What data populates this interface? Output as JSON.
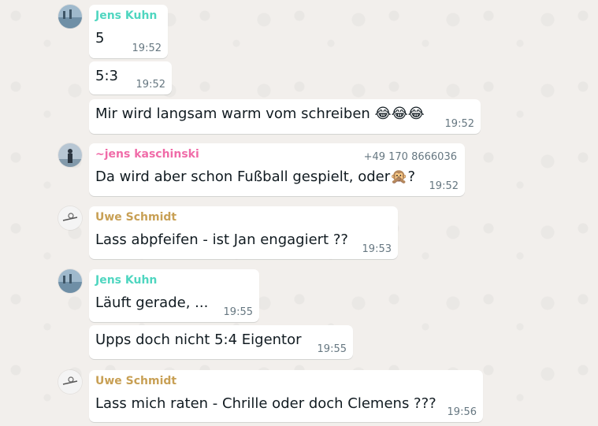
{
  "colors": {
    "background": "#f2efec",
    "bubble": "#ffffff",
    "sender_jens_kuhn": "#4fd6c0",
    "sender_jens_kaschinski": "#f06ba8",
    "sender_uwe": "#c8a055",
    "timestamp": "#667781"
  },
  "messages": [
    {
      "sender": "Jens Kuhn",
      "text": "5",
      "time": "19:52"
    },
    {
      "text": "5:3",
      "time": "19:52"
    },
    {
      "text": "Mir wird langsam warm vom schreiben 😂😂😂",
      "time": "19:52"
    },
    {
      "sender": "~jens kaschinski",
      "phone": "+49 170 8666036",
      "text": "Da wird aber schon Fußball gespielt, oder🙊?",
      "time": "19:52"
    },
    {
      "sender": "Uwe Schmidt",
      "text": "Lass abpfeifen - ist Jan engagiert ??",
      "time": "19:53"
    },
    {
      "sender": "Jens Kuhn",
      "text": "Läuft gerade, ...",
      "time": "19:55"
    },
    {
      "text": "Upps doch nicht 5:4 Eigentor",
      "time": "19:55"
    },
    {
      "sender": "Uwe Schmidt",
      "text": "Lass mich raten - Chrille oder doch Clemens ???",
      "time": "19:56"
    }
  ]
}
